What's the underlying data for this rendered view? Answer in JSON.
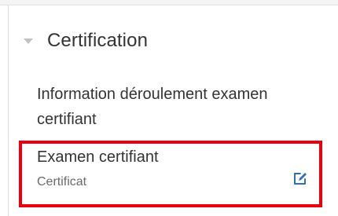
{
  "section": {
    "title": "Certification",
    "caret_icon": "caret-down-icon"
  },
  "activities": [
    {
      "title": "Information déroulement examen certifiant"
    },
    {
      "title": "Examen certifiant",
      "subtitle": "Certificat",
      "action_icon": "edit-icon"
    }
  ],
  "colors": {
    "highlight": "#e8000f",
    "icon_blue": "#2f6fb7",
    "text": "#333333",
    "muted": "#6a6a6a"
  }
}
